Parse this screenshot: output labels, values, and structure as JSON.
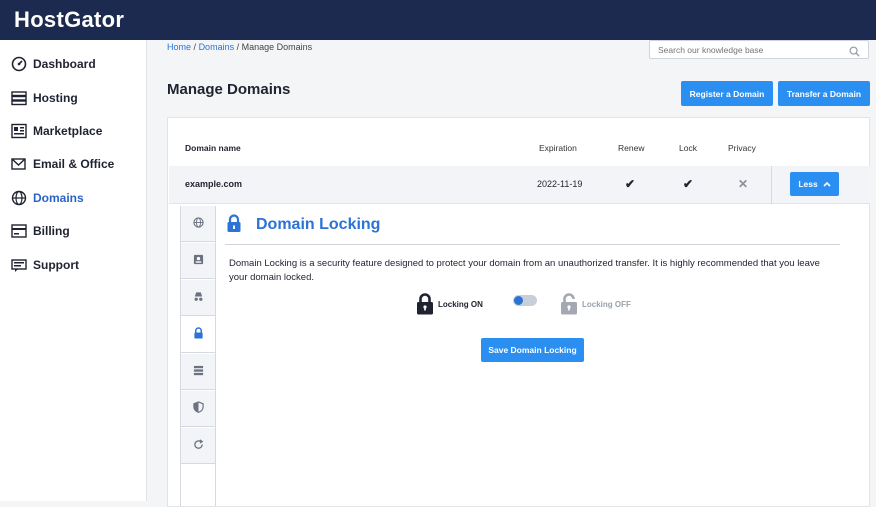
{
  "app": {
    "logo": "HostGator"
  },
  "sidebar": {
    "items": [
      {
        "label": "Dashboard",
        "icon": "dashboard-icon"
      },
      {
        "label": "Hosting",
        "icon": "server-icon"
      },
      {
        "label": "Marketplace",
        "icon": "marketplace-icon"
      },
      {
        "label": "Email & Office",
        "icon": "email-icon"
      },
      {
        "label": "Domains",
        "icon": "globe-icon",
        "active": true
      },
      {
        "label": "Billing",
        "icon": "billing-icon"
      },
      {
        "label": "Support",
        "icon": "support-icon"
      }
    ]
  },
  "breadcrumb": {
    "home": "Home",
    "sep1": "/",
    "domains": "Domains",
    "sep2": "/",
    "current": "Manage Domains"
  },
  "search": {
    "placeholder": "Search our knowledge base"
  },
  "page": {
    "title": "Manage Domains"
  },
  "actions": {
    "register": "Register a Domain",
    "transfer": "Transfer a Domain"
  },
  "table": {
    "headers": {
      "name": "Domain name",
      "expiration": "Expiration",
      "renew": "Renew",
      "lock": "Lock",
      "privacy": "Privacy"
    },
    "row": {
      "domain": "example.com",
      "expiration": "2022-11-19",
      "renew": "✔",
      "lock": "✔",
      "privacy": "✕",
      "less_label": "Less"
    }
  },
  "detail": {
    "title": "Domain Locking",
    "description": "Domain Locking is a security feature designed to protect your domain from an unauthorized transfer. It is highly recommended that you leave your domain locked.",
    "lock_on": "Locking ON",
    "lock_off": "Locking OFF",
    "lock_state_on": true,
    "save": "Save Domain Locking"
  },
  "colors": {
    "accent": "#2b8ff2",
    "brand": "#1c2a4f",
    "link": "#2b73d6"
  }
}
